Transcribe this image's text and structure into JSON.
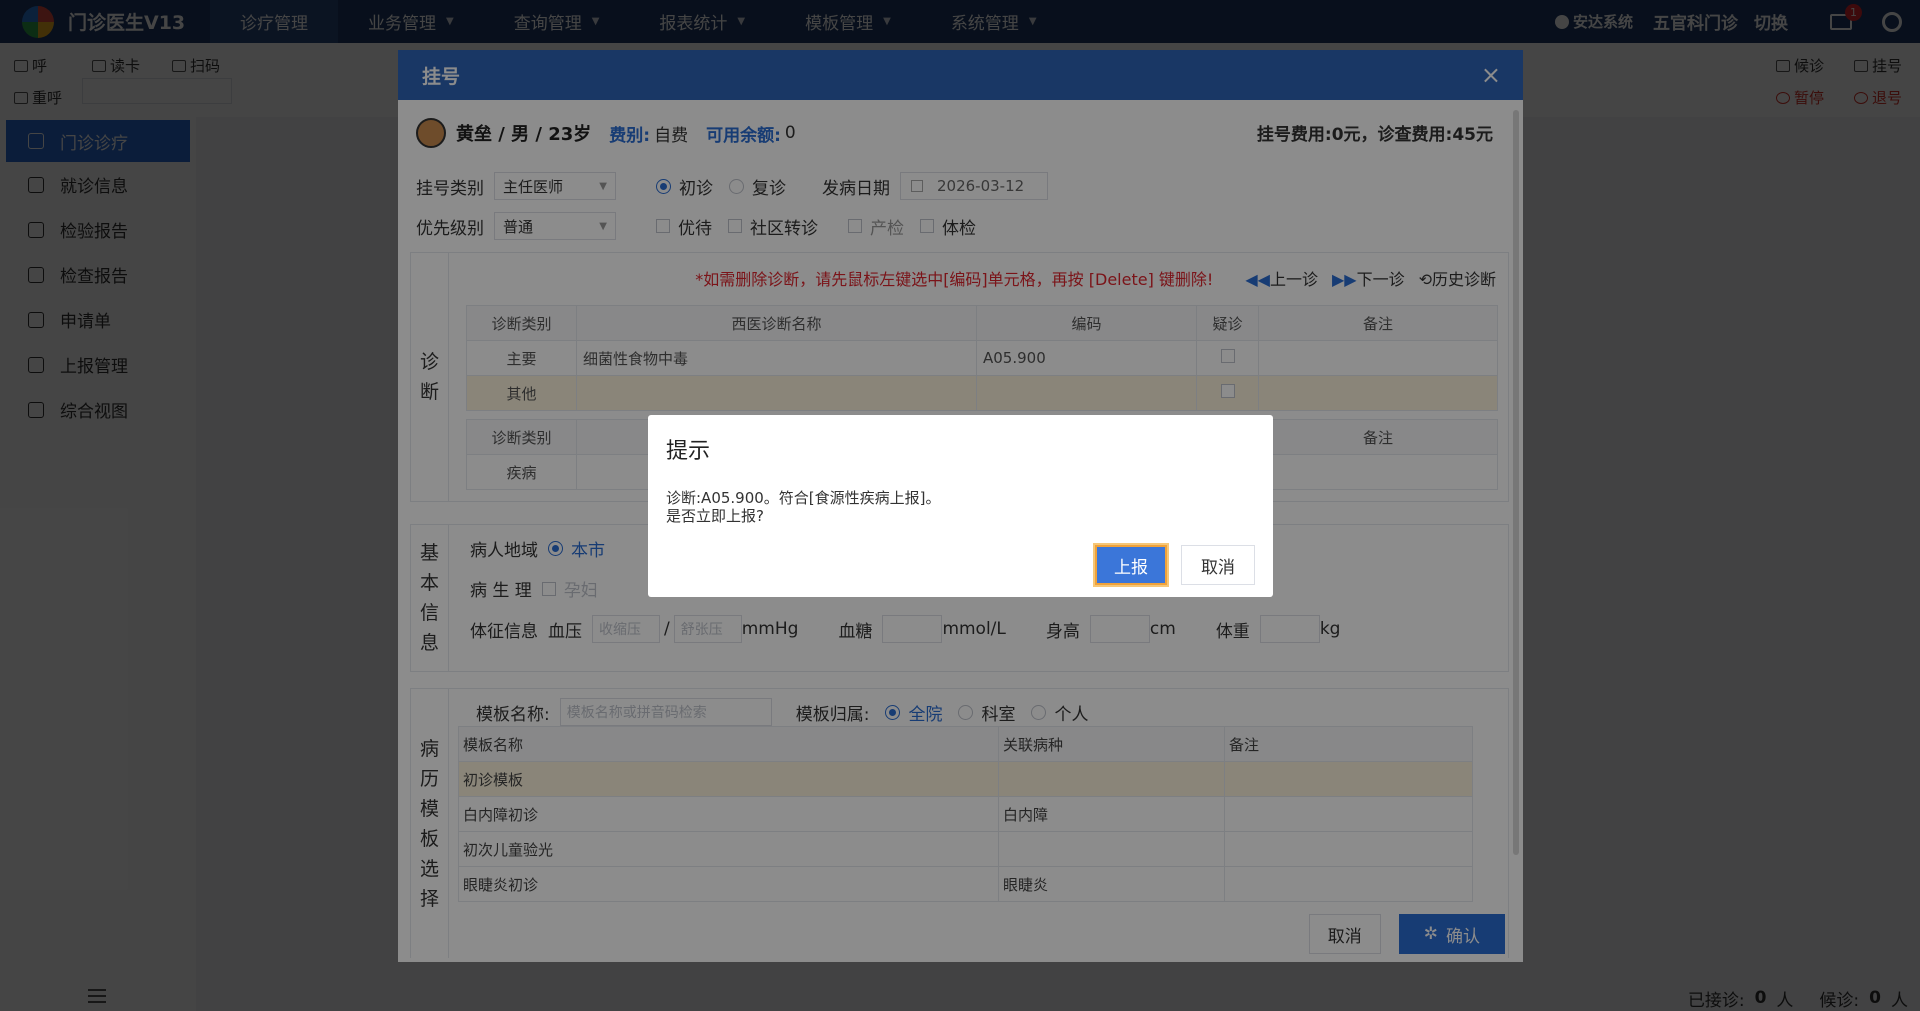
{
  "app": {
    "title": "门诊医生V13"
  },
  "nav": {
    "items": [
      {
        "label": "诊疗管理",
        "active": true,
        "dropdown": false
      },
      {
        "label": "业务管理",
        "active": false,
        "dropdown": true
      },
      {
        "label": "查询管理",
        "active": false,
        "dropdown": true
      },
      {
        "label": "报表统计",
        "active": false,
        "dropdown": true
      },
      {
        "label": "模板管理",
        "active": false,
        "dropdown": true
      },
      {
        "label": "系统管理",
        "active": false,
        "dropdown": true
      }
    ],
    "user": "安达系统",
    "user_sub": "1",
    "dept": "五官科门诊",
    "switch": "切换",
    "mail_badge": "1"
  },
  "toolbar": {
    "call": "呼",
    "card": "读卡",
    "scan": "扫码",
    "recall": "重呼",
    "wait": "候诊",
    "register": "挂号",
    "pause": "暂停",
    "logout": "退号"
  },
  "sidebar": {
    "items": [
      {
        "label": "门诊诊疗",
        "active": true
      },
      {
        "label": "就诊信息",
        "active": false
      },
      {
        "label": "检验报告",
        "active": false
      },
      {
        "label": "检查报告",
        "active": false
      },
      {
        "label": "申请单",
        "active": false
      },
      {
        "label": "上报管理",
        "active": false
      },
      {
        "label": "综合视图",
        "active": false
      }
    ]
  },
  "status": {
    "seen_label": "已接诊:",
    "seen_value": "0",
    "seen_unit": "人",
    "wait_label": "候诊:",
    "wait_value": "0",
    "wait_unit": "人"
  },
  "modal": {
    "title": "挂号",
    "close": "×",
    "patient": {
      "name": "黄垒 / 男 / 23岁",
      "fee_type_label": "费别:",
      "fee_type": "自费",
      "balance_label": "可用余额:",
      "balance": "0"
    },
    "fees": "挂号费用:0元，诊查费用:45元",
    "reg_type_label": "挂号类别",
    "reg_type_value": "主任医师",
    "visit_first": "初诊",
    "visit_return": "复诊",
    "onset_label": "发病日期",
    "onset_value": "2026-03-12",
    "priority_label": "优先级别",
    "priority_value": "普通",
    "flags": [
      "优待",
      "社区转诊",
      "产检",
      "体检"
    ],
    "diagnosis": {
      "vlabel": [
        "诊",
        "断"
      ],
      "warning": "*如需删除诊断，请先鼠标左键选中[编码]单元格，再按 [Delete] 键删除!",
      "prev": "上一诊",
      "next": "下一诊",
      "history": "历史诊断",
      "columns": [
        "诊断类别",
        "西医诊断名称",
        "编码",
        "疑诊",
        "备注"
      ],
      "rows": [
        {
          "type": "主要",
          "name": "细菌性食物中毒",
          "code": "A05.900"
        },
        {
          "type": "其他",
          "name": "",
          "code": ""
        }
      ],
      "columns2_first": "诊断类别",
      "columns2_last": "备注",
      "rows2_first": "疾病"
    },
    "basic": {
      "vlabel": [
        "基",
        "本",
        "信",
        "息"
      ],
      "region_label": "病人地域",
      "region_value": "本市",
      "physio_label": "病 生 理",
      "physio_opt": "孕妇",
      "vitals_label": "体征信息",
      "bp_label": "血压",
      "bp_sys_ph": "收缩压",
      "bp_sep": "/",
      "bp_dia_ph": "舒张压",
      "bp_unit": "mmHg",
      "glucose_label": "血糖",
      "glucose_unit": "mmol/L",
      "height_label": "身高",
      "height_unit": "cm",
      "weight_label": "体重",
      "weight_unit": "kg"
    },
    "template": {
      "vlabel": [
        "病",
        "历",
        "模",
        "板",
        "选",
        "择"
      ],
      "name_label": "模板名称:",
      "name_ph": "模板名称或拼音码检索",
      "owner_label": "模板归属:",
      "owner_opts": [
        "全院",
        "科室",
        "个人"
      ],
      "columns": [
        "模板名称",
        "关联病种",
        "备注"
      ],
      "rows": [
        {
          "name": "初诊模板",
          "disease": "",
          "note": ""
        },
        {
          "name": "白内障初诊",
          "disease": "白内障",
          "note": ""
        },
        {
          "name": "初次儿童验光",
          "disease": "",
          "note": ""
        },
        {
          "name": "眼睫炎初诊",
          "disease": "眼睫炎",
          "note": ""
        }
      ]
    },
    "cancel": "取消",
    "confirm": "确认"
  },
  "dialog": {
    "title": "提示",
    "message_line1": "诊断:A05.900。符合[食源性疾病上报]。",
    "message_line2": "是否立即上报?",
    "ok": "上报",
    "cancel": "取消"
  }
}
